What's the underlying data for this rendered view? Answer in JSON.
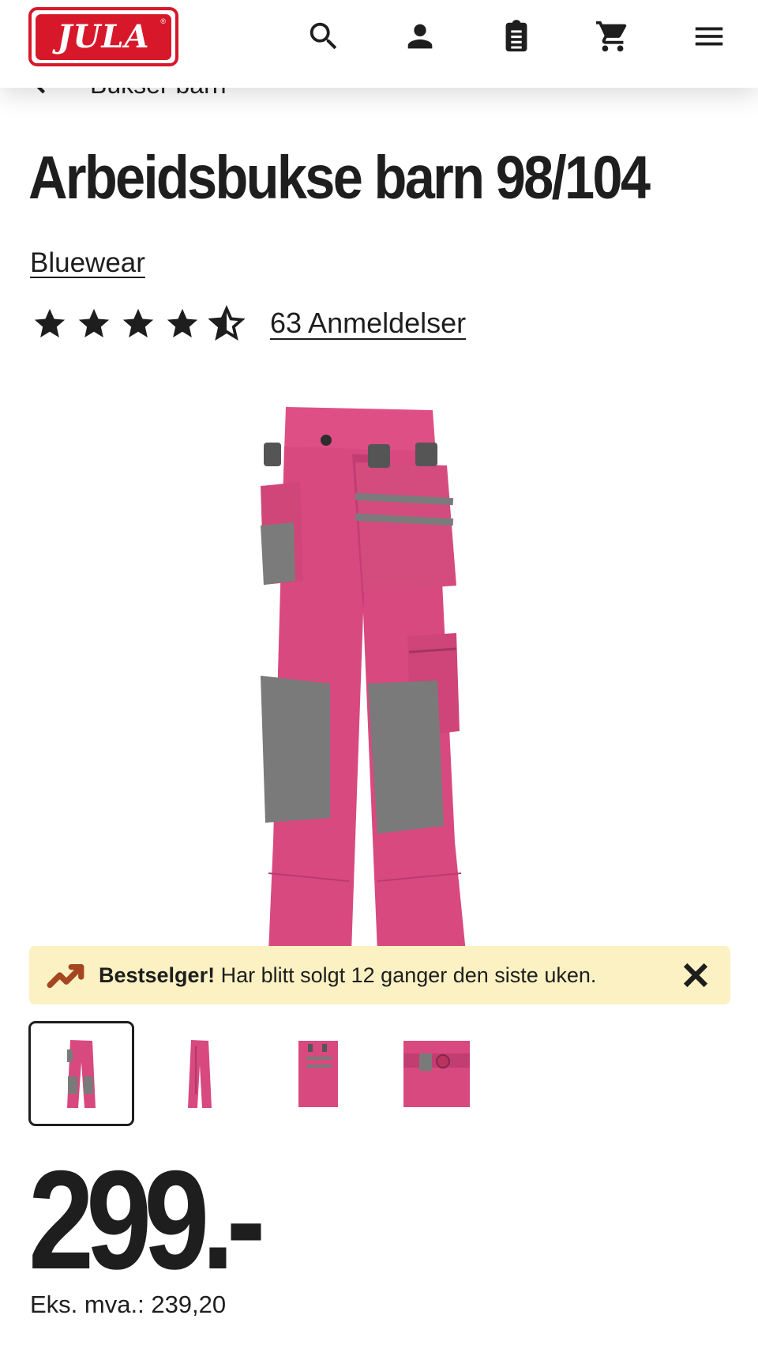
{
  "header": {
    "logo_text": "JULA",
    "logo_reg": "®",
    "brand_color": "#d7182a",
    "icons": [
      "search-icon",
      "account-icon",
      "shopping-list-icon",
      "cart-icon",
      "menu-icon"
    ]
  },
  "breadcrumb": {
    "label": "Bukser barn"
  },
  "product": {
    "title": "Arbeidsbukse barn 98/104",
    "brand": "Bluewear",
    "rating": 4.5,
    "rating_max": 5,
    "reviews_label": "63 Anmeldelser"
  },
  "banner": {
    "highlight": "Bestselger!",
    "text": "Har blitt solgt 12 ganger den siste uken.",
    "background": "#fbf1c3",
    "icon": "trending-up-icon"
  },
  "gallery": {
    "thumbnail_count": 4,
    "selected_index": 0
  },
  "price": {
    "amount": "299.-",
    "ex_vat_label": "Eks. mva.:",
    "ex_vat_value": "239,20"
  }
}
